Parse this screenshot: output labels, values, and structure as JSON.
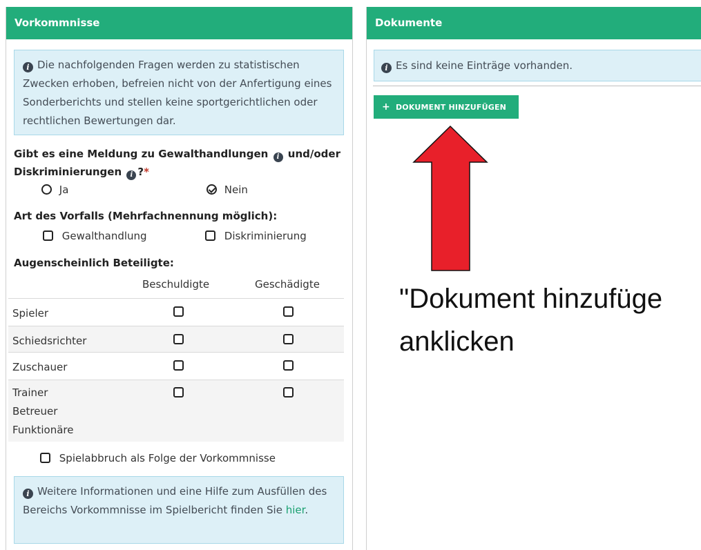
{
  "left_panel": {
    "title": "Vorkommnisse",
    "info_text": "Die nachfolgenden Fragen werden zu statistischen Zwecken erhoben, befreien nicht von der Anfertigung eines Sonderberichts und stellen keine sportgerichtlichen oder rechtlichen Bewertungen dar.",
    "question1_line1": "Gibt es eine Meldung zu Gewalthandlungen",
    "question1_and": "und/oder",
    "question1_line2": "Diskriminierungen",
    "question1_suffix": "?",
    "required_mark": "*",
    "option_ja": "Ja",
    "option_nein": "Nein",
    "selected": "Nein",
    "question2": "Art des Vorfalls (Mehrfachnennung möglich):",
    "checkbox_gewalt": "Gewalthandlung",
    "checkbox_diskr": "Diskriminierung",
    "question3": "Augenscheinlich Beteiligte:",
    "col_beschuldigte": "Beschuldigte",
    "col_geschaedigte": "Geschädigte",
    "rows": [
      {
        "label": "Spieler"
      },
      {
        "label": "Schiedsrichter"
      },
      {
        "label": "Zuschauer"
      },
      {
        "label": "Trainer",
        "label2": "Betreuer",
        "label3": "Funktionäre"
      }
    ],
    "abbruch": "Spielabbruch als Folge der Vorkommnisse",
    "help_text": "Weitere Informationen und eine Hilfe zum Ausfüllen des Bereichs Vorkommnisse im Spielbericht finden Sie",
    "help_link": "hier",
    "help_end": "."
  },
  "right_panel": {
    "title": "Dokumente",
    "empty_text": "Es sind keine Einträge vorhanden.",
    "add_button": "DOKUMENT HINZUFÜGEN",
    "add_icon": "+"
  },
  "annotation": {
    "line1": "\"Dokument hinzufüge",
    "line2": "anklicken",
    "arrow_color": "#e8202a"
  },
  "colors": {
    "header_green": "#22ad7b",
    "info_bg": "#ddf0f7",
    "required_red": "#c0392b"
  }
}
